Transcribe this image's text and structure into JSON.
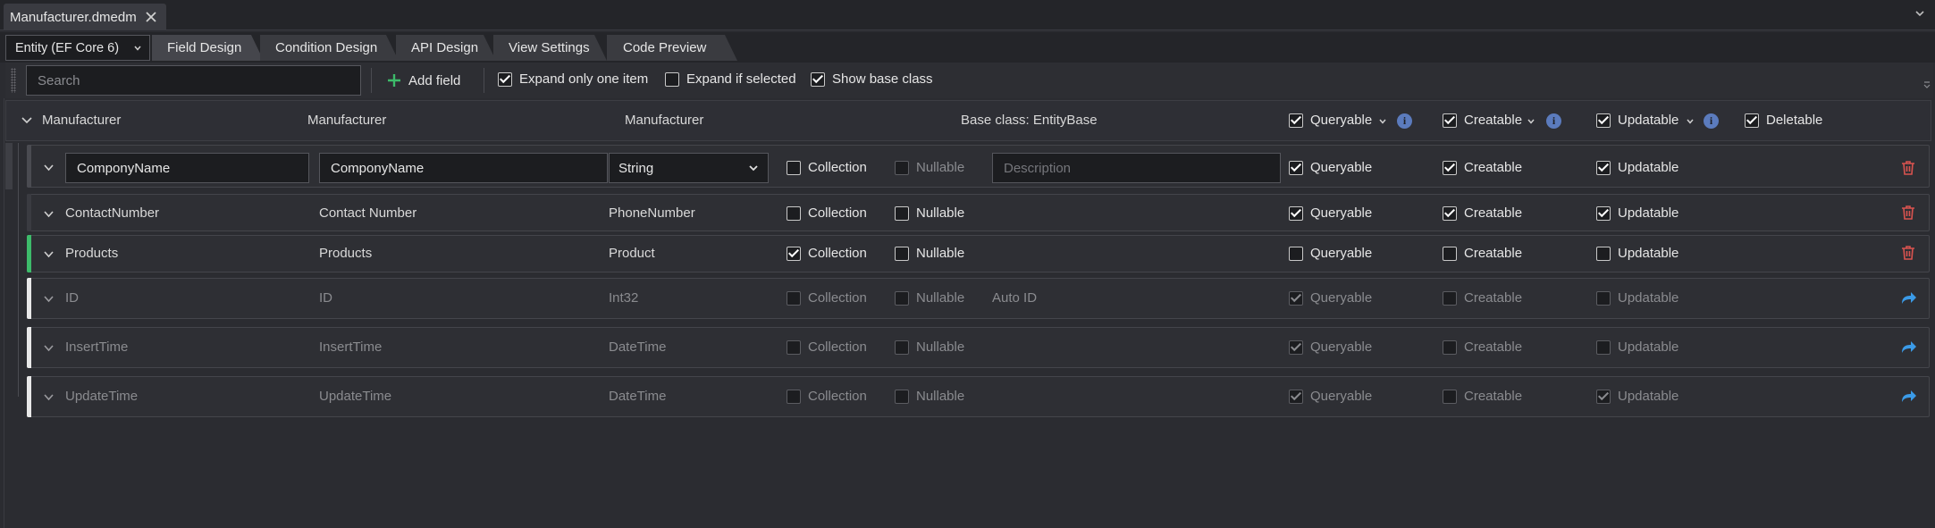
{
  "document_tab": {
    "title": "Manufacturer.dmedm"
  },
  "combo": {
    "value": "Entity (EF Core 6)"
  },
  "tabs": [
    {
      "label": "Field Design"
    },
    {
      "label": "Condition Design"
    },
    {
      "label": "API Design"
    },
    {
      "label": "View Settings"
    },
    {
      "label": "Code Preview"
    }
  ],
  "toolbar": {
    "search_placeholder": "Search",
    "add_field_label": "Add field",
    "expand_only_one_label": "Expand only one item",
    "expand_only_one_checked": true,
    "expand_if_selected_label": "Expand if selected",
    "expand_if_selected_checked": false,
    "show_base_class_label": "Show base class",
    "show_base_class_checked": true
  },
  "entity": {
    "name": "Manufacturer",
    "display_name": "Manufacturer",
    "description": "Manufacturer",
    "base_class": "Base class: EntityBase",
    "queryable_label": "Queryable",
    "creatable_label": "Creatable",
    "updatable_label": "Updatable",
    "deletable_label": "Deletable"
  },
  "labels": {
    "collection": "Collection",
    "nullable": "Nullable",
    "queryable": "Queryable",
    "creatable": "Creatable",
    "updatable": "Updatable",
    "description_placeholder": "Description"
  },
  "fields": [
    {
      "name": "ComponyName",
      "display": "ComponyName",
      "type": "String",
      "extra": "",
      "editing": true,
      "base": false,
      "accent": "#4a4b51",
      "collection": false,
      "nullable": false,
      "queryable": true,
      "creatable": true,
      "updatable": true
    },
    {
      "name": "ContactNumber",
      "display": "Contact Number",
      "type": "PhoneNumber",
      "extra": "",
      "editing": false,
      "base": false,
      "accent": "#3a3b41",
      "collection": false,
      "nullable": false,
      "queryable": true,
      "creatable": true,
      "updatable": true
    },
    {
      "name": "Products",
      "display": "Products",
      "type": "Product",
      "extra": "",
      "editing": false,
      "base": false,
      "accent": "#3dbb6a",
      "collection": true,
      "nullable": false,
      "queryable": false,
      "creatable": false,
      "updatable": false
    },
    {
      "name": "ID",
      "display": "ID",
      "type": "Int32",
      "extra": "Auto ID",
      "editing": false,
      "base": true,
      "accent": "#e8e8e8",
      "collection": false,
      "nullable": false,
      "queryable": true,
      "creatable": false,
      "updatable": false
    },
    {
      "name": "InsertTime",
      "display": "InsertTime",
      "type": "DateTime",
      "extra": "",
      "editing": false,
      "base": true,
      "accent": "#e8e8e8",
      "collection": false,
      "nullable": false,
      "queryable": true,
      "creatable": false,
      "updatable": false
    },
    {
      "name": "UpdateTime",
      "display": "UpdateTime",
      "type": "DateTime",
      "extra": "",
      "editing": false,
      "base": true,
      "accent": "#e8e8e8",
      "collection": false,
      "nullable": false,
      "queryable": true,
      "creatable": false,
      "updatable": true
    }
  ],
  "colors": {
    "delete_icon": "#d9534f",
    "goto_icon": "#3b9be8",
    "add_icon": "#3dbb6a",
    "info_icon": "#5b7bbd"
  },
  "icons": {
    "delete": "trash-icon",
    "goto": "forward-arrow-icon",
    "add": "plus-icon",
    "info": "info-icon"
  }
}
